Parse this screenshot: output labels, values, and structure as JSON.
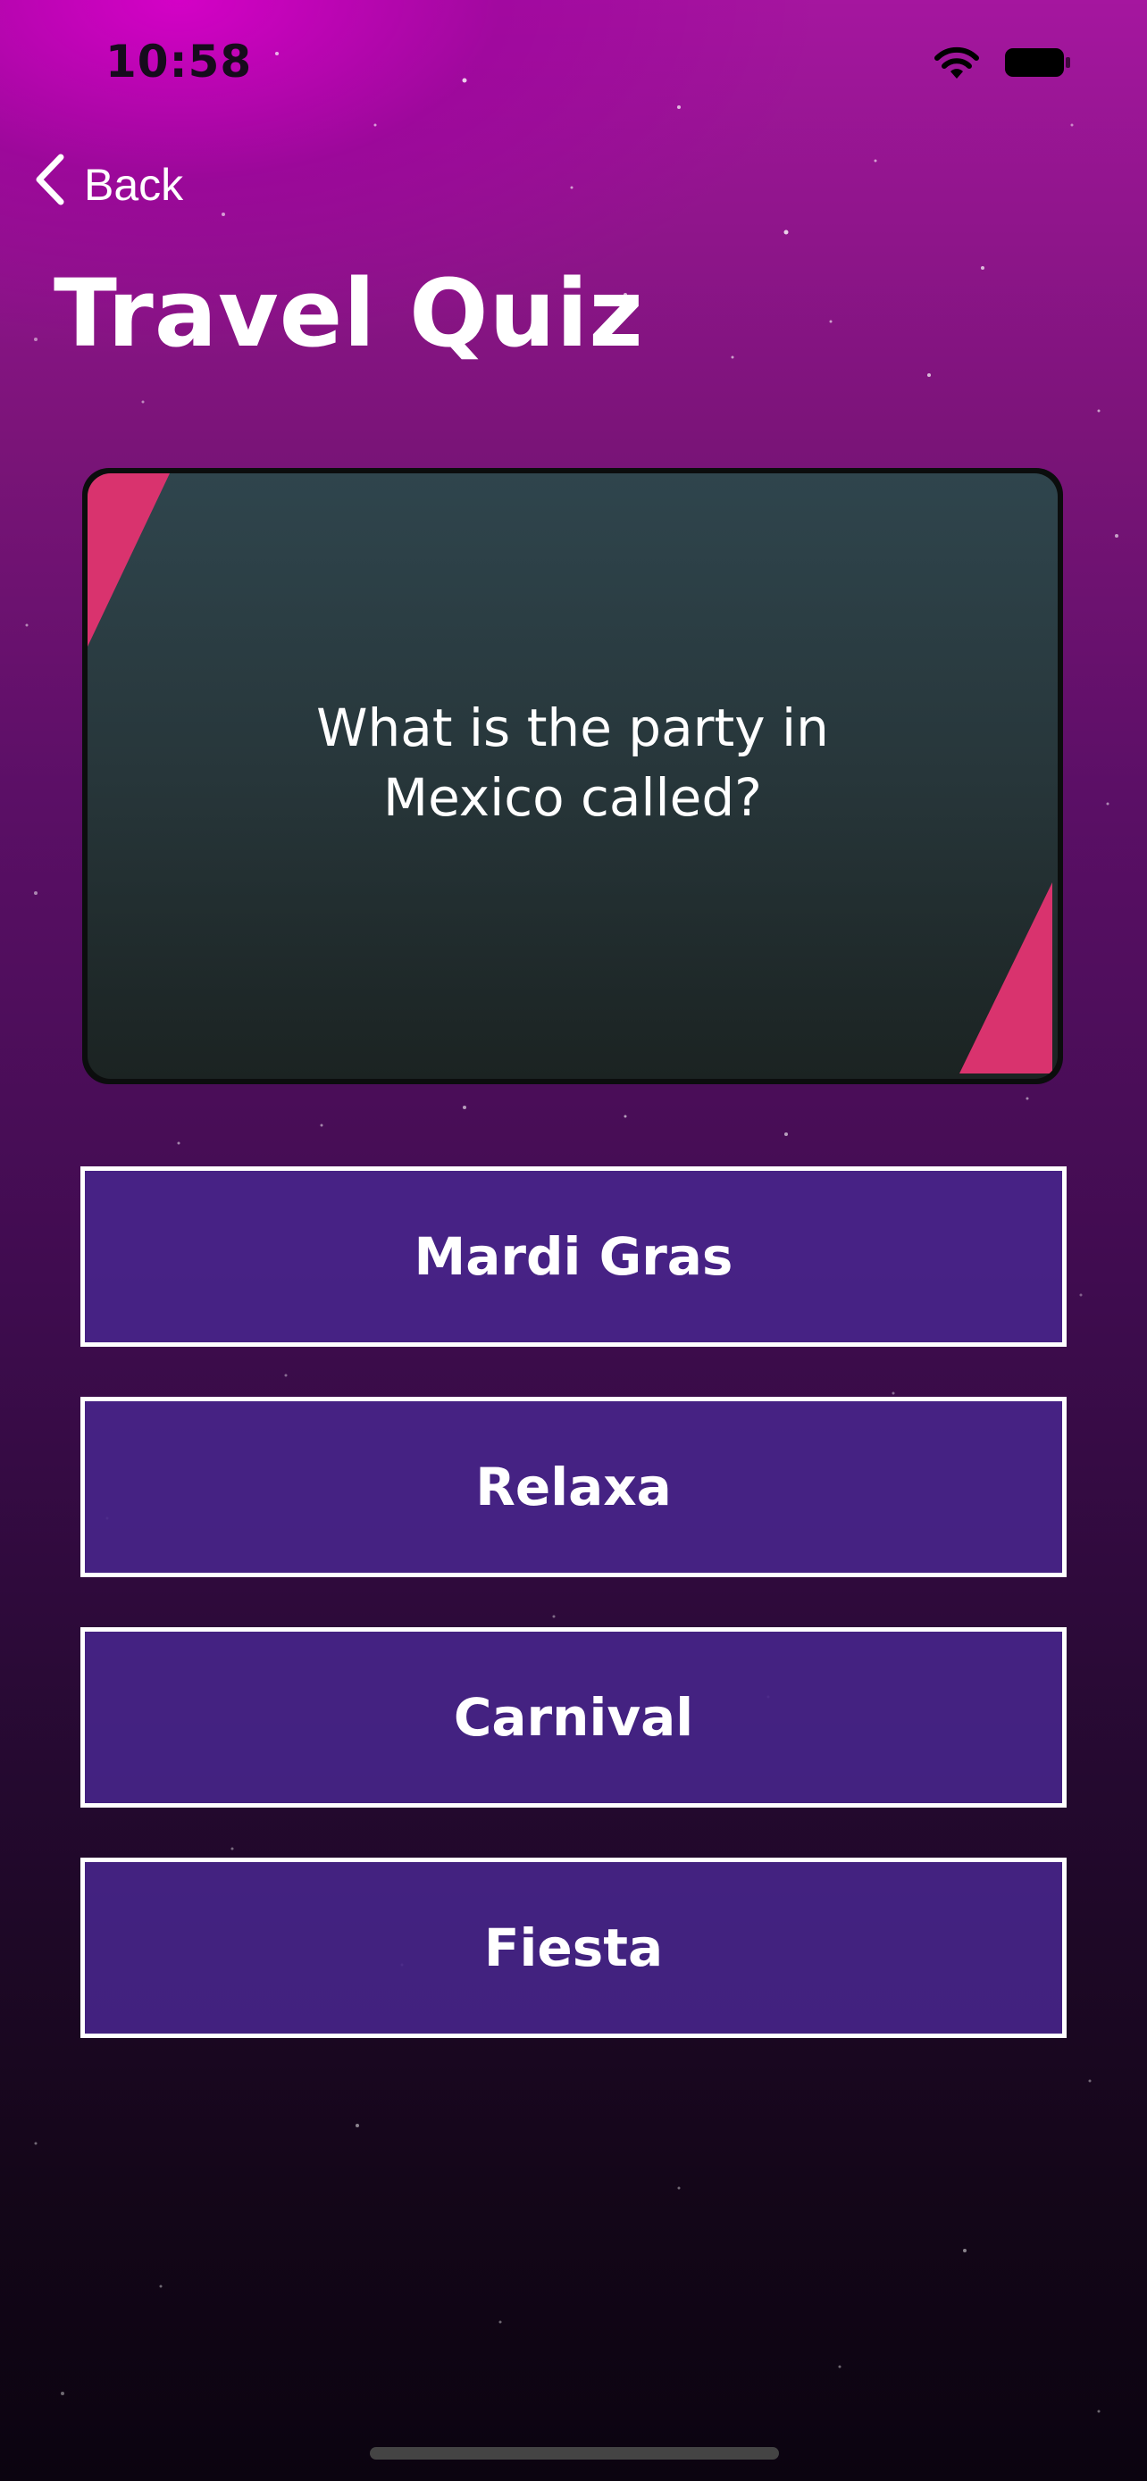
{
  "status_bar": {
    "time": "10:58",
    "icons": [
      "wifi-icon",
      "battery-icon"
    ]
  },
  "nav": {
    "back_label": "Back",
    "back_icon": "chevron-left-icon"
  },
  "page": {
    "title": "Travel Quiz"
  },
  "question_card": {
    "question": "What is the party in Mexico called?",
    "accent_color": "#d9336e"
  },
  "answers": [
    {
      "label": "Mardi Gras"
    },
    {
      "label": "Relaxa"
    },
    {
      "label": "Carnival"
    },
    {
      "label": "Fiesta"
    }
  ],
  "colors": {
    "answer_bg": "#48268c",
    "answer_border": "#ffffff",
    "background_top": "#a5169f",
    "background_bottom": "#0b0410"
  }
}
